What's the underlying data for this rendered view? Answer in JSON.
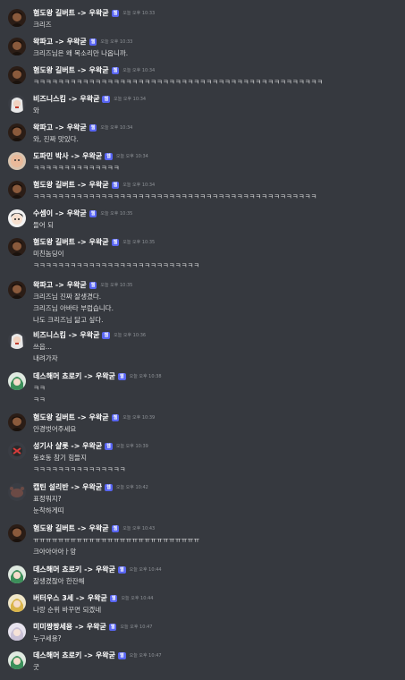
{
  "colors": {
    "background": "#36393f",
    "author": "#ffffff",
    "text": "#dcddde",
    "timestamp": "#8e9297",
    "badge": "#5865f2"
  },
  "messages": [
    {
      "avatar": "avatar-dark",
      "author": "혐도왕 길버트 -> 우왁굳",
      "badge": "웹",
      "time": "오늘 오후 10:33",
      "lines": [
        "크리즈"
      ]
    },
    {
      "avatar": "avatar-dark",
      "author": "왁파고 -> 우왁굳",
      "badge": "웹",
      "time": "오늘 오후 10:33",
      "lines": [
        "크리즈님은 왜 목소리만 나옵니까."
      ]
    },
    {
      "avatar": "avatar-dark",
      "author": "혐도왕 길버트 -> 우왁굳",
      "badge": "웹",
      "time": "오늘 오후 10:34",
      "lines": [
        "ㅋㅋㅋㅋㅋㅋㅋㅋㅋㅋㅋㅋㅋㅋㅋㅋㅋㅋㅋㅋㅋㅋㅋㅋㅋㅋㅋㅋㅋㅋㅋㅋㅋㅋㅋㅋㅋㅋㅋㅋㅋㅋㅋㅋㅋㅋㅋ"
      ]
    },
    {
      "avatar": "avatar-white-hair",
      "author": "비즈니스킴 -> 우왁굳",
      "badge": "웹",
      "time": "오늘 오후 10:34",
      "lines": [
        "와"
      ]
    },
    {
      "avatar": "avatar-dark",
      "author": "왁파고 -> 우왁굳",
      "badge": "웹",
      "time": "오늘 오후 10:34",
      "lines": [
        "와, 진짜 맛있다."
      ]
    },
    {
      "avatar": "avatar-bald",
      "author": "도파민 박사 -> 우왁굳",
      "badge": "웹",
      "time": "오늘 오후 10:34",
      "lines": [
        "ㅋㅋㅋㅋㅋㅋㅋㅋㅋㅋㅋㅋㅋㅋ"
      ]
    },
    {
      "avatar": "avatar-dark",
      "author": "혐도왕 길버트 -> 우왁굳",
      "badge": "웹",
      "time": "오늘 오후 10:34",
      "lines": [
        "ㅋㅋㅋㅋㅋㅋㅋㅋㅋㅋㅋㅋㅋㅋㅋㅋㅋㅋㅋㅋㅋㅋㅋㅋㅋㅋㅋㅋㅋㅋㅋㅋㅋㅋㅋㅋㅋㅋㅋㅋㅋㅋㅋㅋㅋㅋ"
      ]
    },
    {
      "avatar": "avatar-face",
      "author": "수셈이 -> 우왁굳",
      "badge": "웹",
      "time": "오늘 오후 10:35",
      "lines": [
        "들어 되"
      ]
    },
    {
      "avatar": "avatar-dark",
      "author": "혐도왕 길버트 -> 우왁굳",
      "badge": "웹",
      "time": "오늘 오후 10:35",
      "lines": [
        "미친놈딩이",
        "ㅋㅋㅋㅋㅋㅋㅋㅋㅋㅋㅋㅋㅋㅋㅋㅋㅋㅋㅋㅋㅋㅋㅋㅋㅋㅋㅋ"
      ]
    },
    {
      "avatar": "avatar-dark",
      "author": "왁파고 -> 우왁굳",
      "badge": "웹",
      "time": "오늘 오후 10:35",
      "lines": [
        "크리즈님 진짜 잘생겼다.",
        "크리즈님 아바타 부럽습니다.",
        "나도 크리즈님 닮고 싶다."
      ]
    },
    {
      "avatar": "avatar-white-hair",
      "author": "비즈니스킴 -> 우왁굳",
      "badge": "웹",
      "time": "오늘 오후 10:36",
      "lines": [
        "쓰읍...",
        "내려가자"
      ]
    },
    {
      "avatar": "avatar-green",
      "author": "데스해머 쵸로키 -> 우왁굳",
      "badge": "웹",
      "time": "오늘 오후 10:38",
      "lines": [
        "ㅋㅋ",
        "ㅋㅋ"
      ]
    },
    {
      "avatar": "avatar-dark",
      "author": "혐도왕 길버트 -> 우왁굳",
      "badge": "웹",
      "time": "오늘 오후 10:39",
      "lines": [
        "안경벗어주세요"
      ]
    },
    {
      "avatar": "avatar-red",
      "author": "성기사 샬롯 -> 우왁굳",
      "badge": "웹",
      "time": "오늘 오후 10:39",
      "lines": [
        "동호동 참기 힘들지",
        "ㅋㅋㅋㅋㅋㅋㅋㅋㅋㅋㅋㅋㅋㅋㅋ"
      ]
    },
    {
      "avatar": "avatar-crab",
      "author": "캡틴 설리반 -> 우왁굳",
      "badge": "웹",
      "time": "오늘 오후 10:42",
      "lines": [
        "표정뭐지?",
        "눈착하게띠"
      ]
    },
    {
      "avatar": "avatar-dark",
      "author": "혐도왕 길버트 -> 우왁굳",
      "badge": "웹",
      "time": "오늘 오후 10:43",
      "lines": [
        "ㅠㅠㅠㅠㅠㅠㅠㅠㅠㅠㅠㅠㅠㅠㅠㅠㅠㅠㅠㅠㅠㅠㅠㅠㅠㅠㅠ",
        "크아아아아ㅏ앙"
      ]
    },
    {
      "avatar": "avatar-green",
      "author": "데스해머 쵸로키 -> 우왁굳",
      "badge": "웹",
      "time": "오늘 오후 10:44",
      "lines": [
        "잘생겼잖아 한잔해"
      ]
    },
    {
      "avatar": "avatar-yellow",
      "author": "버터우스 3세 -> 우왁굳",
      "badge": "웹",
      "time": "오늘 오후 10:44",
      "lines": [
        "나랑 순위 바꾸면 되겠네"
      ]
    },
    {
      "avatar": "avatar-pale",
      "author": "미미짱짱세용 -> 우왁굳",
      "badge": "웹",
      "time": "오늘 오후 10:47",
      "lines": [
        "누구세용?"
      ]
    },
    {
      "avatar": "avatar-green",
      "author": "데스해머 쵸로키 -> 우왁굳",
      "badge": "웹",
      "time": "오늘 오후 10:47",
      "lines": [
        "굿"
      ]
    }
  ]
}
